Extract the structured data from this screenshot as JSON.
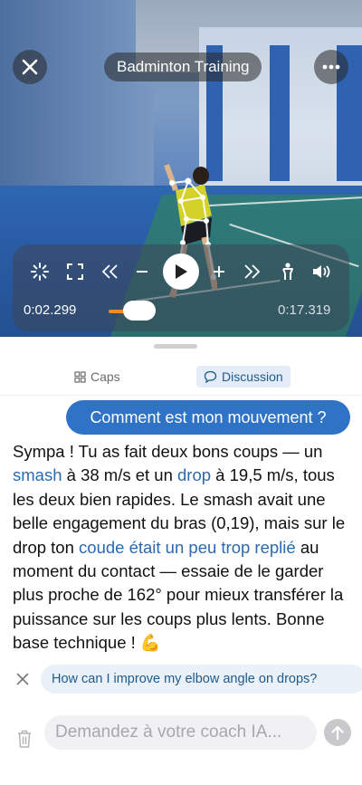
{
  "video": {
    "title": "Badminton Training",
    "current_time": "0:02.299",
    "duration": "0:17.319",
    "progress_fraction": 0.133,
    "close_icon": "close-icon",
    "more_icon": "more-icon"
  },
  "controls": {
    "icons": [
      "loading-icon",
      "fullscreen-icon",
      "rewind-icon",
      "minus-icon",
      "play-icon",
      "plus-icon",
      "fast-forward-icon",
      "person-icon",
      "volume-icon"
    ],
    "accent": "#f08a2b"
  },
  "tabs": [
    {
      "label": "Caps",
      "icon": "grid-icon",
      "active": false
    },
    {
      "label": "Discussion",
      "icon": "chat-bubble-icon",
      "active": true
    }
  ],
  "chat": {
    "user_message": "Comment est mon mouvement ?",
    "reply": {
      "p1": "Sympa ! Tu as fait deux bons coups — un ",
      "smash": "smash",
      "p2": " à 38 m/s et un ",
      "drop": "drop",
      "p3": " à 19,5 m/s, tous les deux bien rapides. Le smash avait une belle engagement du bras (0,19), mais sur le drop ton ",
      "coude": "coude était un peu trop replié",
      "p4": " au moment du contact — essaie de le garder plus proche de 162° pour mieux transférer la puissance sur les coups plus lents. Bonne base technique ! ",
      "emoji": "💪"
    },
    "suggestion": "How can I improve my elbow angle on drops?",
    "input_placeholder": "Demandez à votre coach IA...",
    "colors": {
      "user_bubble": "#2f73c7",
      "link": "#2a6ab0"
    }
  }
}
